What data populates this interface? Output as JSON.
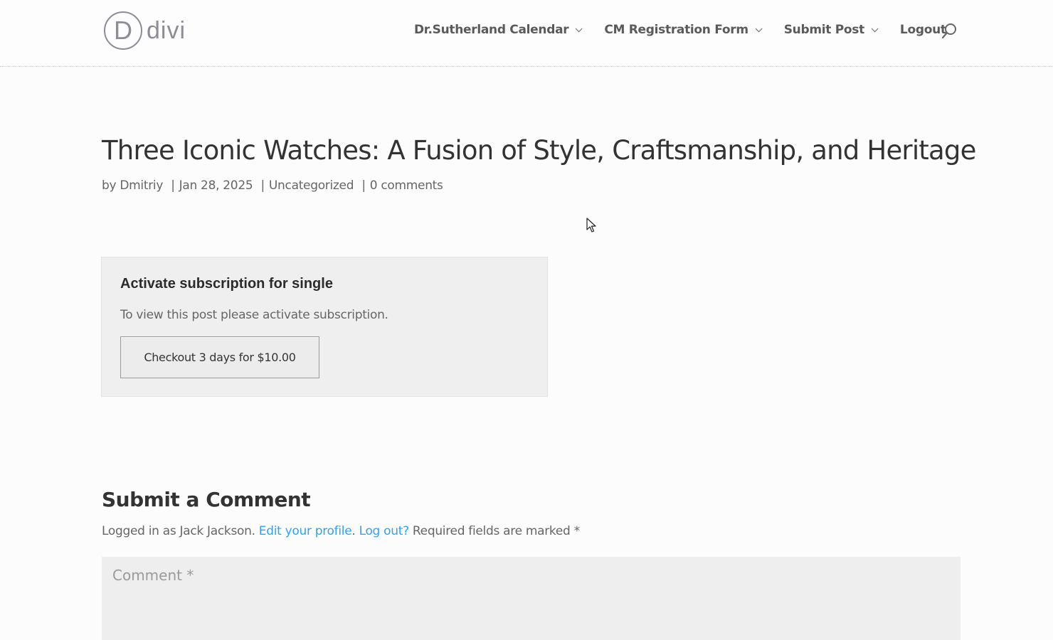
{
  "header": {
    "logo_letter": "D",
    "logo_text": "divi",
    "nav": [
      {
        "label": "Dr.Sutherland Calendar",
        "has_dropdown": true
      },
      {
        "label": "CM Registration Form",
        "has_dropdown": true
      },
      {
        "label": "Submit Post",
        "has_dropdown": true
      },
      {
        "label": "Logout",
        "has_dropdown": false
      }
    ],
    "search_icon": "search-icon"
  },
  "post": {
    "title": "Three Iconic Watches: A Fusion of Style, Craftsmanship, and Heritage",
    "meta_by": "by",
    "author": "Dmitriy",
    "date": "Jan 28, 2025",
    "category": "Uncategorized",
    "comments": "0 comments",
    "separator": "|"
  },
  "subscription": {
    "heading": "Activate subscription for single",
    "text": "To view this post please activate subscription.",
    "button_label": "Checkout 3 days for $10.00"
  },
  "comment_form": {
    "title": "Submit a Comment",
    "logged_in_prefix": "Logged in as Jack Jackson.",
    "edit_profile_link": "Edit your profile",
    "period": ".",
    "logout_link": "Log out?",
    "required_note": "Required fields are marked *",
    "comment_placeholder": "Comment *"
  },
  "colors": {
    "link": "#2ea3f2",
    "heading": "#333333",
    "body_text": "#666666",
    "box_bg": "#efefef"
  }
}
